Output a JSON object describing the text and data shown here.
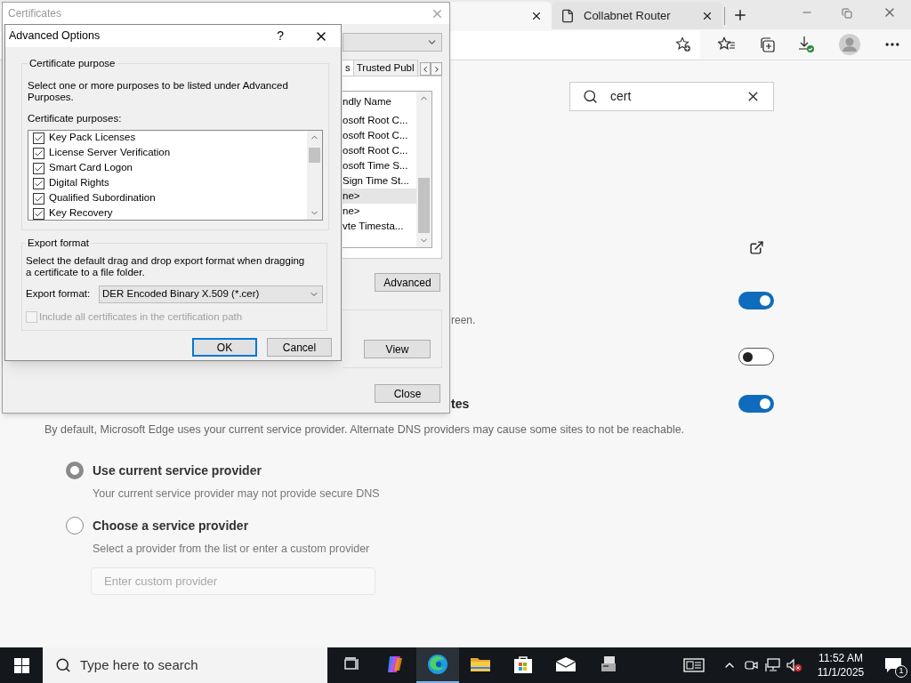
{
  "browser": {
    "tabs": [
      {
        "selected": true
      },
      {
        "title": "Collabnet Router",
        "selected": false
      }
    ],
    "settings_search": {
      "value": "cert"
    },
    "settings_rows": [
      {
        "kind": "link"
      },
      {
        "kind": "toggle",
        "on": true,
        "description": "reen."
      },
      {
        "kind": "toggle",
        "on": false
      },
      {
        "kind": "toggle",
        "on": true,
        "title": "tes"
      }
    ],
    "dns": {
      "description": "By default, Microsoft Edge uses your current service provider. Alternate DNS providers may cause some sites to not be reachable.",
      "options": [
        {
          "label": "Use current service provider",
          "description": "Your current service provider may not provide secure DNS",
          "selected": true
        },
        {
          "label": "Choose a service provider",
          "description": "Select a provider from the list or enter a custom provider",
          "selected": false
        }
      ],
      "custom_provider": {
        "placeholder": "Enter custom provider"
      }
    }
  },
  "certificates_window": {
    "title": "Certificates",
    "tabs": [
      {
        "label": "s",
        "selected": true
      },
      {
        "label": "Trusted Publ",
        "selected": false
      }
    ],
    "list": {
      "header": "ndly Name",
      "rows": [
        {
          "text": "osoft Root C...",
          "selected": false
        },
        {
          "text": "osoft Root C...",
          "selected": false
        },
        {
          "text": "osoft Root C...",
          "selected": false
        },
        {
          "text": "osoft Time S...",
          "selected": false
        },
        {
          "text": "Sign Time St...",
          "selected": false
        },
        {
          "text": "ne>",
          "selected": true
        },
        {
          "text": "ne>",
          "selected": false
        },
        {
          "text": "vte Timesta...",
          "selected": false
        }
      ]
    },
    "advanced_button": "Advanced",
    "view_button": "View",
    "close_button": "Close"
  },
  "advanced_options": {
    "title": "Advanced Options",
    "help": "?",
    "purpose_group": {
      "legend": "Certificate purpose",
      "description": "Select one or more purposes to be listed under Advanced Purposes.",
      "list_label": "Certificate purposes:",
      "purposes": [
        {
          "label": "Key Pack Licenses",
          "checked": true
        },
        {
          "label": "License Server Verification",
          "checked": true
        },
        {
          "label": "Smart Card Logon",
          "checked": true
        },
        {
          "label": "Digital Rights",
          "checked": true
        },
        {
          "label": "Qualified Subordination",
          "checked": true
        },
        {
          "label": "Key Recovery",
          "checked": true
        }
      ]
    },
    "export_group": {
      "legend": "Export format",
      "description": "Select the default drag and drop export format when dragging a certificate to a file folder.",
      "format_label": "Export format:",
      "format_value": "DER Encoded Binary X.509 (*.cer)",
      "include_path": {
        "label": "Include all certificates in the certification path",
        "checked": false
      }
    },
    "buttons": [
      {
        "label": "OK",
        "default": true
      },
      {
        "label": "Cancel",
        "default": false
      }
    ]
  },
  "taskbar": {
    "search_placeholder": "Type here to search",
    "apps": [
      {
        "kind": "task-view",
        "selected": false
      },
      {
        "kind": "copilot",
        "selected": false
      },
      {
        "kind": "browser",
        "selected": true
      },
      {
        "kind": "folder",
        "selected": false
      },
      {
        "kind": "store",
        "selected": false
      },
      {
        "kind": "mail",
        "selected": false
      },
      {
        "kind": "computer",
        "selected": false
      }
    ],
    "time": "11:52 AM",
    "date": "11/1/2025",
    "notification_count": "1"
  }
}
